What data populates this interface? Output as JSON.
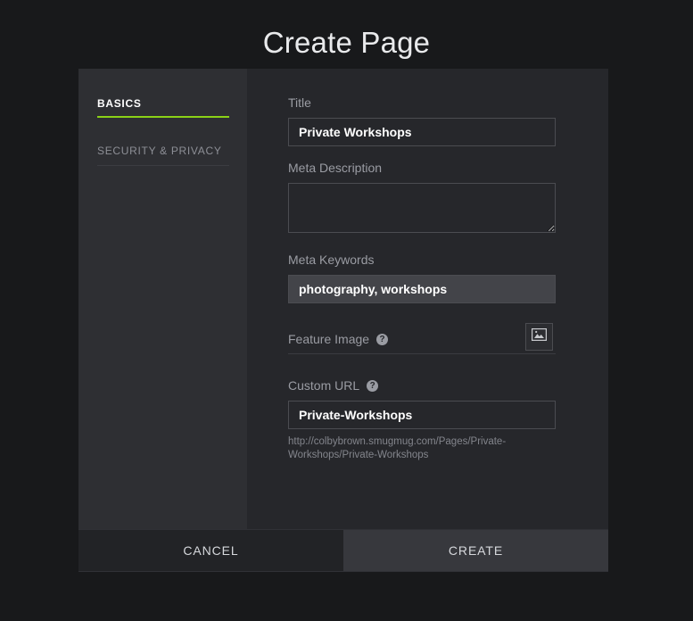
{
  "header": {
    "title": "Create Page"
  },
  "sidebar": {
    "items": [
      {
        "label": "BASICS",
        "active": true
      },
      {
        "label": "SECURITY & PRIVACY",
        "active": false
      }
    ]
  },
  "form": {
    "title_field": {
      "label": "Title",
      "value": "Private Workshops",
      "placeholder": ""
    },
    "meta_description_field": {
      "label": "Meta Description",
      "value": "",
      "placeholder": ""
    },
    "meta_keywords_field": {
      "label": "Meta Keywords",
      "value": "photography, workshops",
      "placeholder": ""
    },
    "feature_image_field": {
      "label": "Feature Image",
      "help": "?",
      "button_icon": "picture-icon"
    },
    "custom_url_field": {
      "label": "Custom URL",
      "help": "?",
      "value": "Private-Workshops",
      "placeholder": "",
      "preview": "http://colbybrown.smugmug.com/Pages/Private-Workshops/Private-Workshops"
    }
  },
  "footer": {
    "cancel_label": "CANCEL",
    "create_label": "CREATE"
  },
  "colors": {
    "accent_green": "#8bd117",
    "page_background": "#18191b",
    "modal_background": "#26272b",
    "sidebar_background": "#2e2f33",
    "input_hover_background": "#434449",
    "label_text": "#9a9ca3"
  }
}
